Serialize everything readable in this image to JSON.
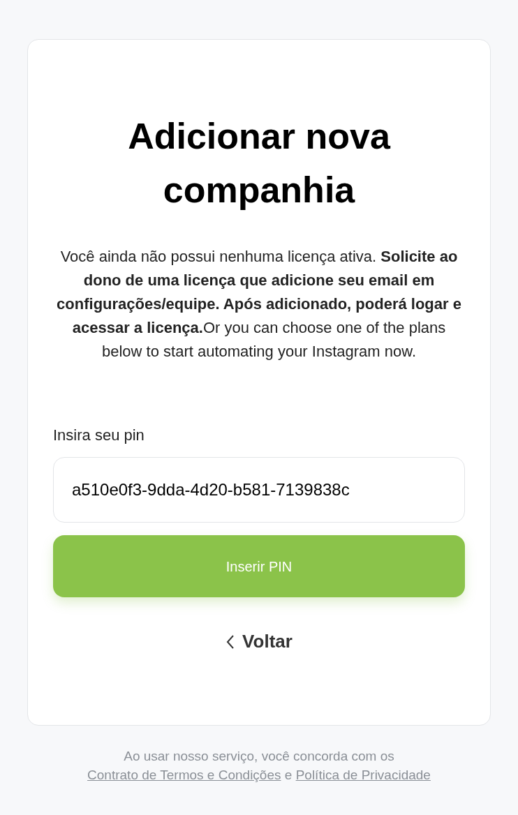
{
  "card": {
    "title": "Adicionar nova companhia",
    "description": "Você ainda não possui nenhuma licença ativa. **Solicite ao dono de uma licença que adicione seu email em configurações/equipe. Após adicionado, poderá logar e acessar a licença.**Or you can choose one of the plans below to start automating your Instagram now.",
    "pin_field": {
      "label": "Insira seu pin",
      "value": "a510e0f3-9dda-4d20-b581-7139838c"
    },
    "submit_button": "Inserir PIN",
    "back_link": "Voltar"
  },
  "footer": {
    "text": "Ao usar nosso serviço, você concorda com os",
    "terms_link": "Contrato de Termos e Condições",
    "joiner": "e",
    "privacy_link": "Política de Privacidade"
  }
}
